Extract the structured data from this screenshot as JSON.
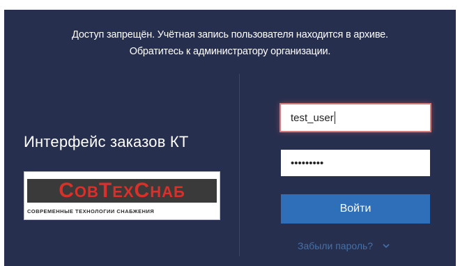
{
  "message": {
    "line1": "Доступ запрещён. Учётная запись пользователя находится в архиве.",
    "line2": "Обратитесь к администратору организации."
  },
  "app_title": "Интерфейс заказов КТ",
  "logo": {
    "c1": "С",
    "p1": "ОВ",
    "c2": "Т",
    "p2": "ЕХ",
    "c3": "С",
    "p3": "НАБ",
    "subtitle": "СОВРЕМЕННЫЕ ТЕХНОЛОГИИ СНАБЖЕНИЯ"
  },
  "form": {
    "username_value": "test_user",
    "password_mask": "•••••••••",
    "login_label": "Войти",
    "forgot_label": "Забыли пароль?"
  },
  "icons": {
    "forgot_chevron": "chevron-down-icon"
  },
  "colors": {
    "panel": "#272f4f",
    "button": "#2f6eb8",
    "link": "#4670a6",
    "focus_ring": "#d97a7a",
    "logo_red": "#d9302a"
  }
}
